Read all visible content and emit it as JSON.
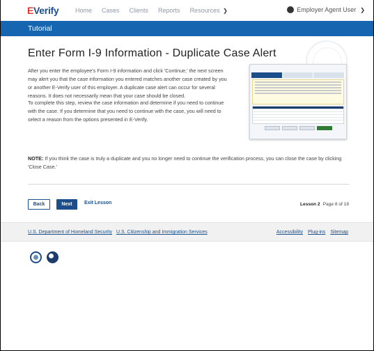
{
  "brand": {
    "logo_e": "E",
    "logo_rest": "Verify"
  },
  "nav": {
    "links": [
      "Home",
      "Cases",
      "Clients",
      "Reports",
      "Resources"
    ],
    "user": "Employer Agent User"
  },
  "tutorial_bar": {
    "title": "Tutorial"
  },
  "page": {
    "title": "Enter Form I-9 Information - Duplicate Case Alert",
    "para1": "After you enter the employee's Form I-9 information and click 'Continue,' the next screen may alert you that the case information you entered matches another case created by you or another E-Verify user of this employer. A duplicate case alert can occur for several reasons. It does not necessarily mean that your case should be closed.",
    "para2": "To complete this step, review the case information and determine if you need to continue with the case. If you determine that you need to continue with the case, you will need to select a reason from the options presented in E-Verify.",
    "note_label": "NOTE:",
    "note_text": " If you think the case is truly a duplicate and you no longer need to continue the verification process, you can close the case by clicking 'Close Case.'"
  },
  "controls": {
    "back": "Back",
    "next": "Next",
    "exit": "Exit Lesson",
    "lesson_label": "Lesson 2",
    "page_of": "Page 8 of 18"
  },
  "footer": {
    "left_links": [
      "U.S. Department of Homeland Security",
      "U.S. Citizenship and Immigration Services"
    ],
    "right_links": [
      "Accessibility",
      "Plug-ins",
      "Sitemap"
    ]
  },
  "colors": {
    "primary": "#1b4e8a",
    "bar": "#1565b0",
    "logo_red": "#d83933"
  }
}
